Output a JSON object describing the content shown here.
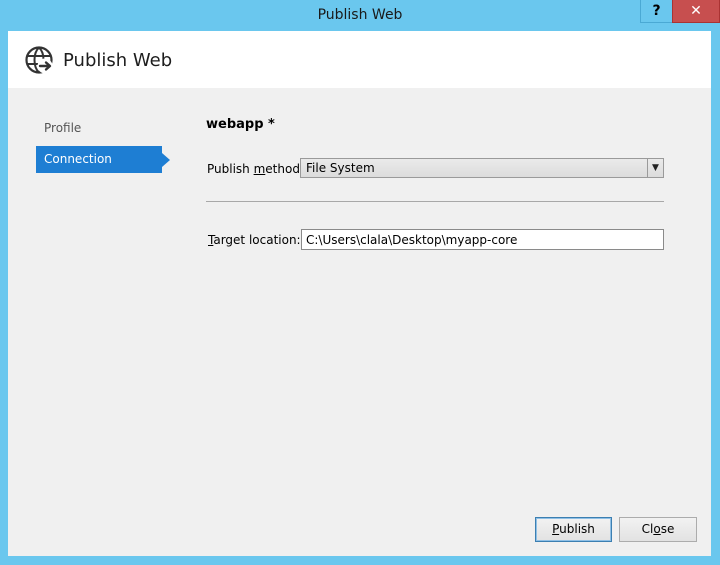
{
  "window": {
    "title": "Publish Web",
    "help_button": "?",
    "close_button": "✕"
  },
  "header": {
    "title": "Publish Web"
  },
  "sidebar": {
    "items": [
      {
        "label": "Profile"
      },
      {
        "label": "Connection"
      }
    ],
    "selected": "Connection"
  },
  "main": {
    "profile_name": "webapp *",
    "publish_method": {
      "label_pre": "Publish ",
      "label_mnemonic": "m",
      "label_post": "ethod:",
      "value": "File System"
    },
    "target_location": {
      "label_mnemonic": "T",
      "label_post": "arget location:",
      "value": "C:\\Users\\clala\\Desktop\\myapp-core"
    }
  },
  "footer": {
    "publish": {
      "mnemonic": "P",
      "rest": "ublish"
    },
    "close": {
      "pre": "Cl",
      "mnemonic": "o",
      "post": "se"
    }
  },
  "colors": {
    "titlebar": "#6ac7ee",
    "accent": "#1e7ed3",
    "close_button": "#c74f4f"
  }
}
